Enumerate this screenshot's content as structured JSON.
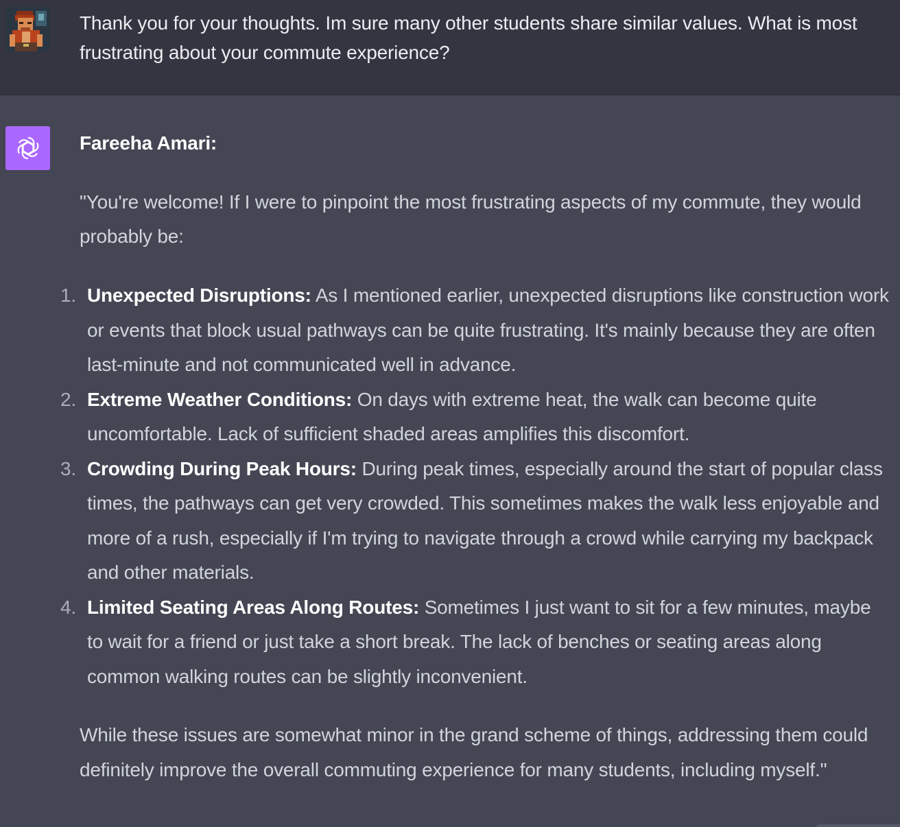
{
  "user_message": {
    "text": "Thank you for your thoughts. Im sure many other students share similar values. What is most frustrating about your commute experience?",
    "avatar_icon": "pixel-art-character-avatar"
  },
  "assistant_message": {
    "avatar_icon": "openai-logo-icon",
    "avatar_color": "#ab68ff",
    "speaker": "Fareeha Amari:",
    "intro": "\"You're welcome! If I were to pinpoint the most frustrating aspects of my commute, they would probably be:",
    "items": [
      {
        "number": "1.",
        "term": "Unexpected Disruptions:",
        "text": " As I mentioned earlier, unexpected disruptions like construction work or events that block usual pathways can be quite frustrating. It's mainly because they are often last-minute and not communicated well in advance."
      },
      {
        "number": "2.",
        "term": "Extreme Weather Conditions:",
        "text": " On days with extreme heat, the walk can become quite uncomfortable. Lack of sufficient shaded areas amplifies this discomfort."
      },
      {
        "number": "3.",
        "term": "Crowding During Peak Hours:",
        "text": " During peak times, especially around the start of popular class times, the pathways can get very crowded. This sometimes makes the walk less enjoyable and more of a rush, especially if I'm trying to navigate through a crowd while carrying my backpack and other materials."
      },
      {
        "number": "4.",
        "term": "Limited Seating Areas Along Routes:",
        "text": " Sometimes I just want to sit for a few minutes, maybe to wait for a friend or just take a short break. The lack of benches or seating areas along common walking routes can be slightly inconvenient."
      }
    ],
    "outro": "While these issues are somewhat minor in the grand scheme of things, addressing them could definitely improve the overall commuting experience for many students, including myself.\""
  },
  "colors": {
    "user_bg": "#343541",
    "assistant_bg": "#444654",
    "text": "#d1d5db",
    "strong": "#ffffff"
  }
}
